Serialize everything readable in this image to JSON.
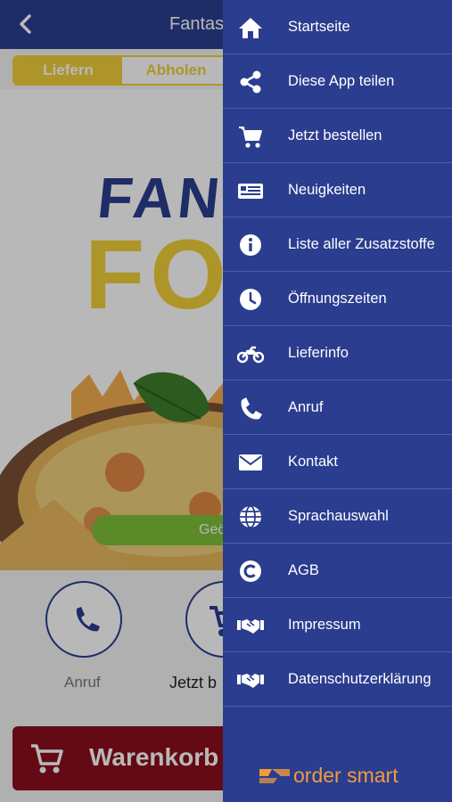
{
  "background": {
    "header_title": "Fantas",
    "tabs": [
      "Liefern",
      "Abholen"
    ],
    "hero": {
      "logo_line1": "FANT",
      "logo_line2": "FO",
      "pill_text": "Geö"
    },
    "actions": [
      {
        "label": "Anruf",
        "icon": "phone-icon"
      },
      {
        "label": "Jetzt b",
        "icon": "cart-icon"
      }
    ],
    "cart_button": "Warenkorb"
  },
  "drawer": {
    "items": [
      {
        "label": "Startseite",
        "icon": "home-icon"
      },
      {
        "label": "Diese App teilen",
        "icon": "share-icon"
      },
      {
        "label": "Jetzt bestellen",
        "icon": "cart-icon"
      },
      {
        "label": "Neuigkeiten",
        "icon": "newspaper-icon"
      },
      {
        "label": "Liste aller Zusatzstoffe",
        "icon": "info-icon"
      },
      {
        "label": "Öffnungszeiten",
        "icon": "clock-icon"
      },
      {
        "label": "Lieferinfo",
        "icon": "motorbike-icon"
      },
      {
        "label": "Anruf",
        "icon": "phone-icon"
      },
      {
        "label": "Kontakt",
        "icon": "envelope-icon"
      },
      {
        "label": "Sprachauswahl",
        "icon": "globe-icon"
      },
      {
        "label": "AGB",
        "icon": "copyright-icon"
      },
      {
        "label": "Impressum",
        "icon": "handshake-icon"
      },
      {
        "label": "Datenschutzerklärung",
        "icon": "handshake-icon"
      }
    ],
    "brand": "order smart"
  },
  "colors": {
    "primary": "#2a3d8f",
    "accent": "#f2cf3a",
    "cart": "#8b0f1e",
    "brand": "#f39a3a",
    "green": "#7fbf3a"
  }
}
